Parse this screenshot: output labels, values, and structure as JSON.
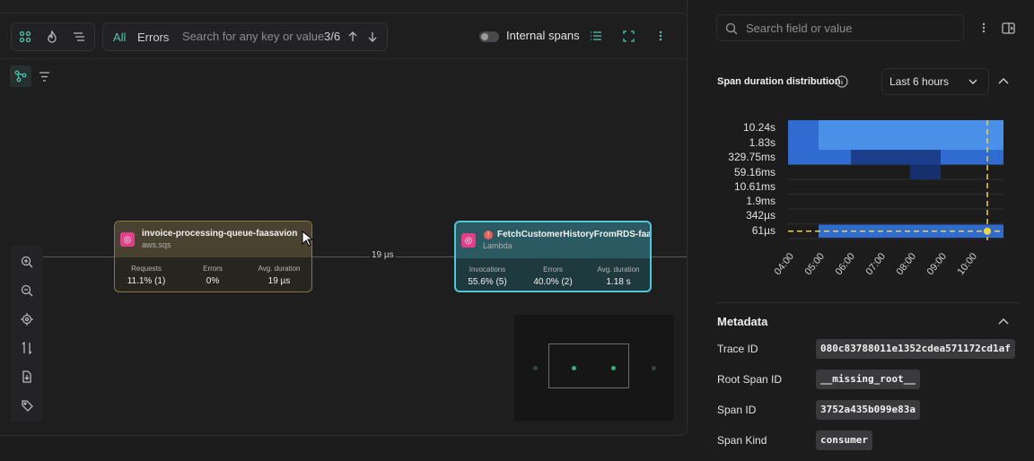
{
  "toolbar": {
    "filter_all": "All",
    "filter_errors": "Errors",
    "search_placeholder": "Search for any key or value",
    "match_count": "3/6",
    "internal_spans_label": "Internal spans"
  },
  "graph": {
    "edge_label": "19 µs",
    "node1": {
      "title": "invoice-processing-queue-faasavion",
      "subtitle": "aws.sqs",
      "stats": [
        {
          "label": "Requests",
          "value": "11.1% (1)"
        },
        {
          "label": "Errors",
          "value": "0%"
        },
        {
          "label": "Avg. duration",
          "value": "19 µs"
        }
      ]
    },
    "node2": {
      "title": "FetchCustomerHistoryFromRDS-faas",
      "subtitle": "Lambda",
      "stats": [
        {
          "label": "Invocations",
          "value": "55.6% (5)"
        },
        {
          "label": "Errors",
          "value": "40.0% (2)"
        },
        {
          "label": "Avg. duration",
          "value": "1.18 s"
        }
      ]
    }
  },
  "panel": {
    "search_placeholder": "Search field or value",
    "distribution_title": "Span duration distribution",
    "time_range": "Last 6 hours",
    "metadata_title": "Metadata",
    "metadata": [
      {
        "key": "Trace ID",
        "value": "080c83788011e1352cdea571172cd1af"
      },
      {
        "key": "Root Span ID",
        "value": "__missing_root__"
      },
      {
        "key": "Span ID",
        "value": "3752a435b099e83a"
      },
      {
        "key": "Span Kind",
        "value": "consumer"
      }
    ]
  },
  "chart_data": {
    "type": "heatmap",
    "y_categories": [
      "10.24s",
      "1.83s",
      "329.75ms",
      "59.16ms",
      "10.61ms",
      "1.9ms",
      "342µs",
      "61µs"
    ],
    "x_ticks": [
      "04:00",
      "05:00",
      "06:00",
      "07:00",
      "08:00",
      "09:00",
      "10:00"
    ],
    "highlight_x": "10:00",
    "highlight_y": "61µs",
    "colors": {
      "high": "#4a8fe8",
      "mid": "#2f6bd0",
      "low": "#1c3e8a",
      "highlight": "#f3d33a"
    }
  },
  "colors": {
    "accent": "#4ec8d8",
    "node_icon": "#e43d8a",
    "error": "#e5605a"
  }
}
